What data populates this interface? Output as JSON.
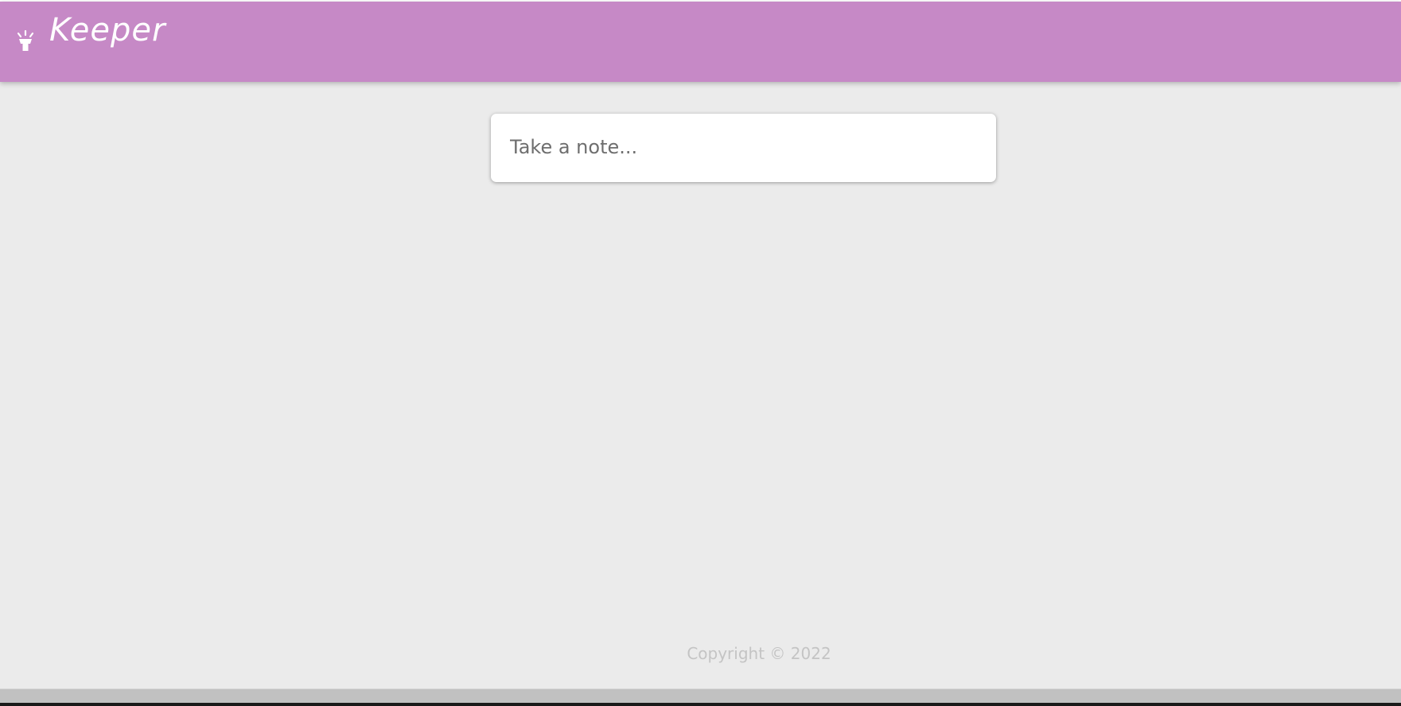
{
  "header": {
    "title": "Keeper",
    "icon": "lightbulb-icon",
    "background_color": "#c689c6"
  },
  "note_form": {
    "placeholder": "Take a note...",
    "value": ""
  },
  "footer": {
    "copyright": "Copyright © 2022"
  },
  "colors": {
    "page_background": "#ebebeb",
    "footer_text": "#c4c4c4"
  }
}
